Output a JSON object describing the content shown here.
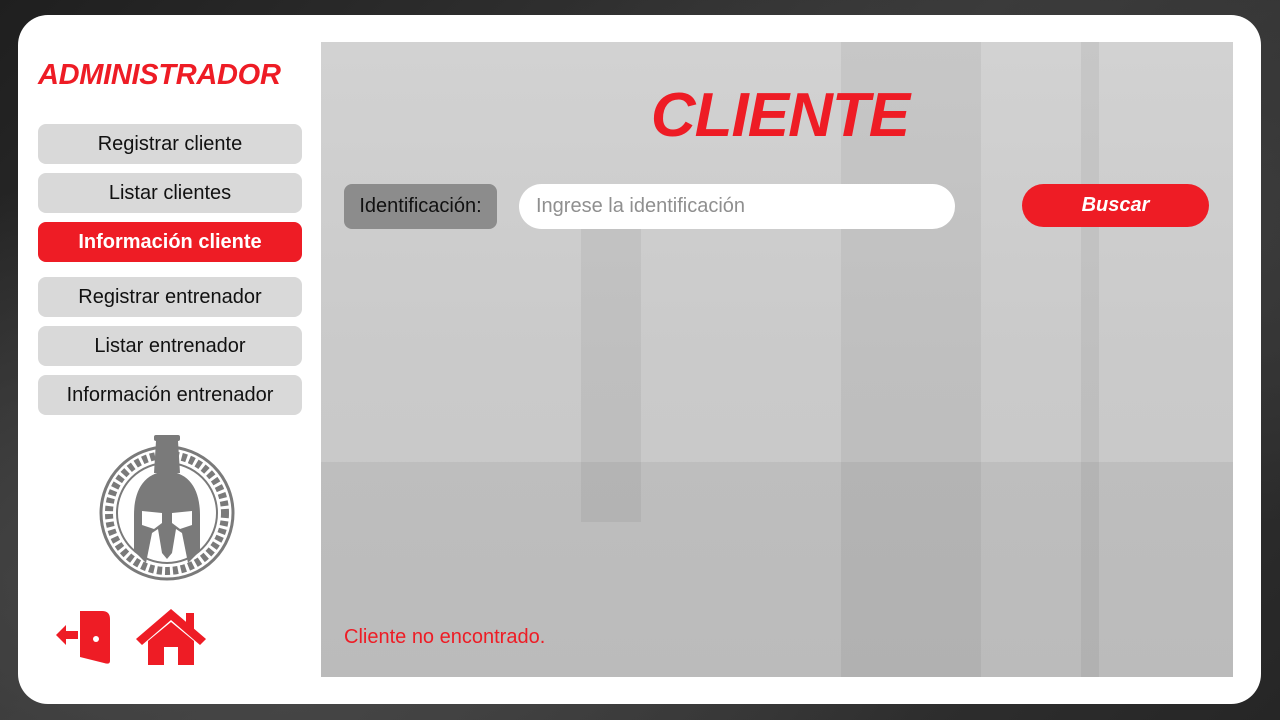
{
  "colors": {
    "accent": "#ee1c25",
    "nav_bg": "#d9d9d9",
    "label_bg": "#8c8c8c"
  },
  "sidebar": {
    "title": "ADMINISTRADOR",
    "items": [
      {
        "label": "Registrar cliente",
        "active": false
      },
      {
        "label": "Listar clientes",
        "active": false
      },
      {
        "label": "Información cliente",
        "active": true
      },
      {
        "label": "Registrar entrenador",
        "active": false
      },
      {
        "label": "Listar entrenador",
        "active": false
      },
      {
        "label": "Información entrenador",
        "active": false
      }
    ],
    "logo_icon": "spartan-helmet-icon",
    "bottom_icons": [
      "exit-icon",
      "home-icon"
    ]
  },
  "main": {
    "title": "CLIENTE",
    "search": {
      "label": "Identificación:",
      "value": "",
      "placeholder": "Ingrese la identificación",
      "button_label": "Buscar"
    },
    "status_message": "Cliente no encontrado."
  }
}
